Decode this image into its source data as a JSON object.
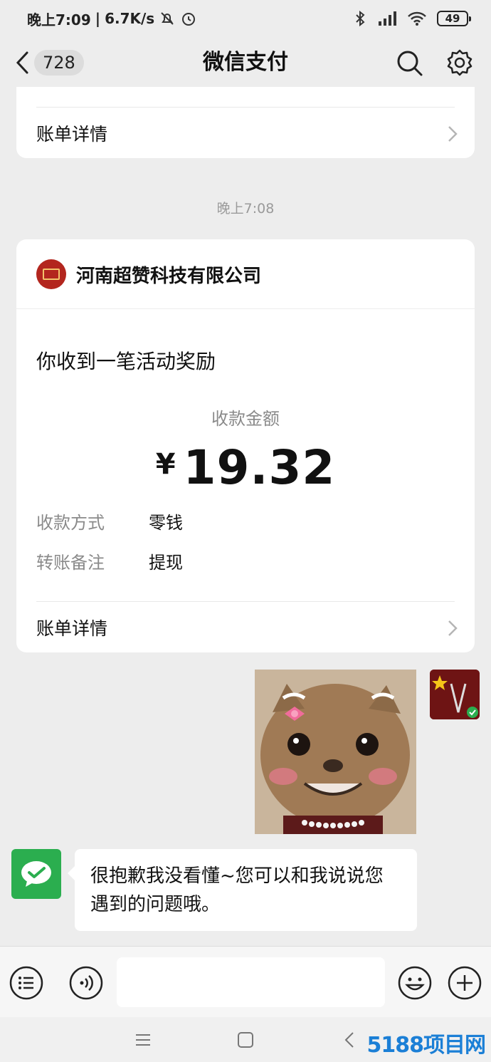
{
  "status_bar": {
    "time": "晚上7:09",
    "net_speed": "6.7K/s",
    "battery": "49"
  },
  "nav": {
    "unread_count": "728",
    "title": "微信支付"
  },
  "top_card": {
    "bill_details": "账单详情"
  },
  "timestamp": "晚上7:08",
  "payment_card": {
    "merchant": "河南超赞科技有限公司",
    "headline": "你收到一笔活动奖励",
    "amount_label": "收款金额",
    "currency": "¥",
    "amount": "19.32",
    "method_key": "收款方式",
    "method_value": "零钱",
    "note_key": "转账备注",
    "note_value": "提现",
    "bill_details": "账单详情"
  },
  "chat": {
    "bot_message": "很抱歉我没看懂~您可以和我说说您遇到的问题哦。"
  },
  "input_bar": {
    "placeholder": ""
  },
  "watermark": "5188项目网",
  "colors": {
    "background": "#ededed",
    "card": "#ffffff",
    "wechat_green": "#2bae4f",
    "merchant_red": "#b3261e"
  }
}
